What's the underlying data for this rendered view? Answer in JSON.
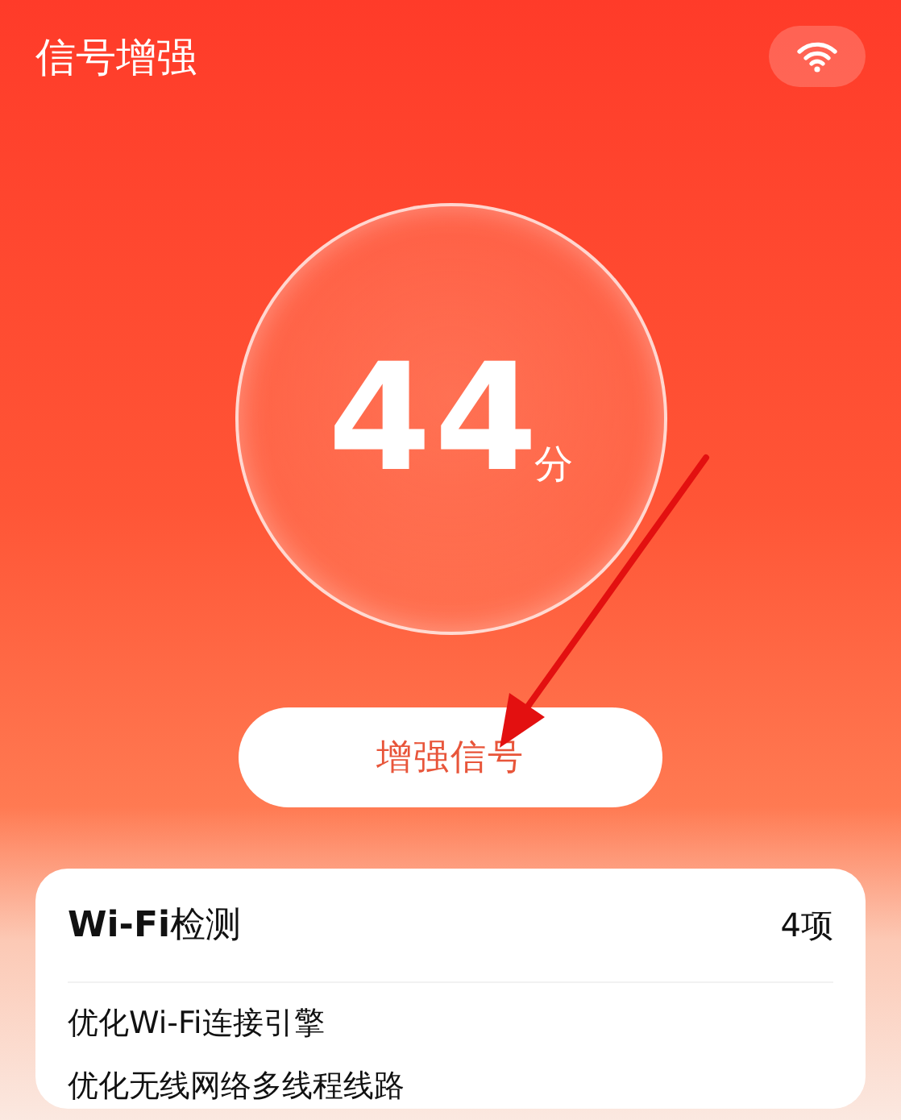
{
  "header": {
    "title": "信号增强"
  },
  "score": {
    "value": "44",
    "unit": "分"
  },
  "boost_button": {
    "label": "增强信号"
  },
  "card": {
    "title": "**Wi-Fi**检测",
    "count": "4项",
    "items": [
      "优化Wi-Fi连接引擎",
      "优化无线网络多线程线路"
    ]
  }
}
